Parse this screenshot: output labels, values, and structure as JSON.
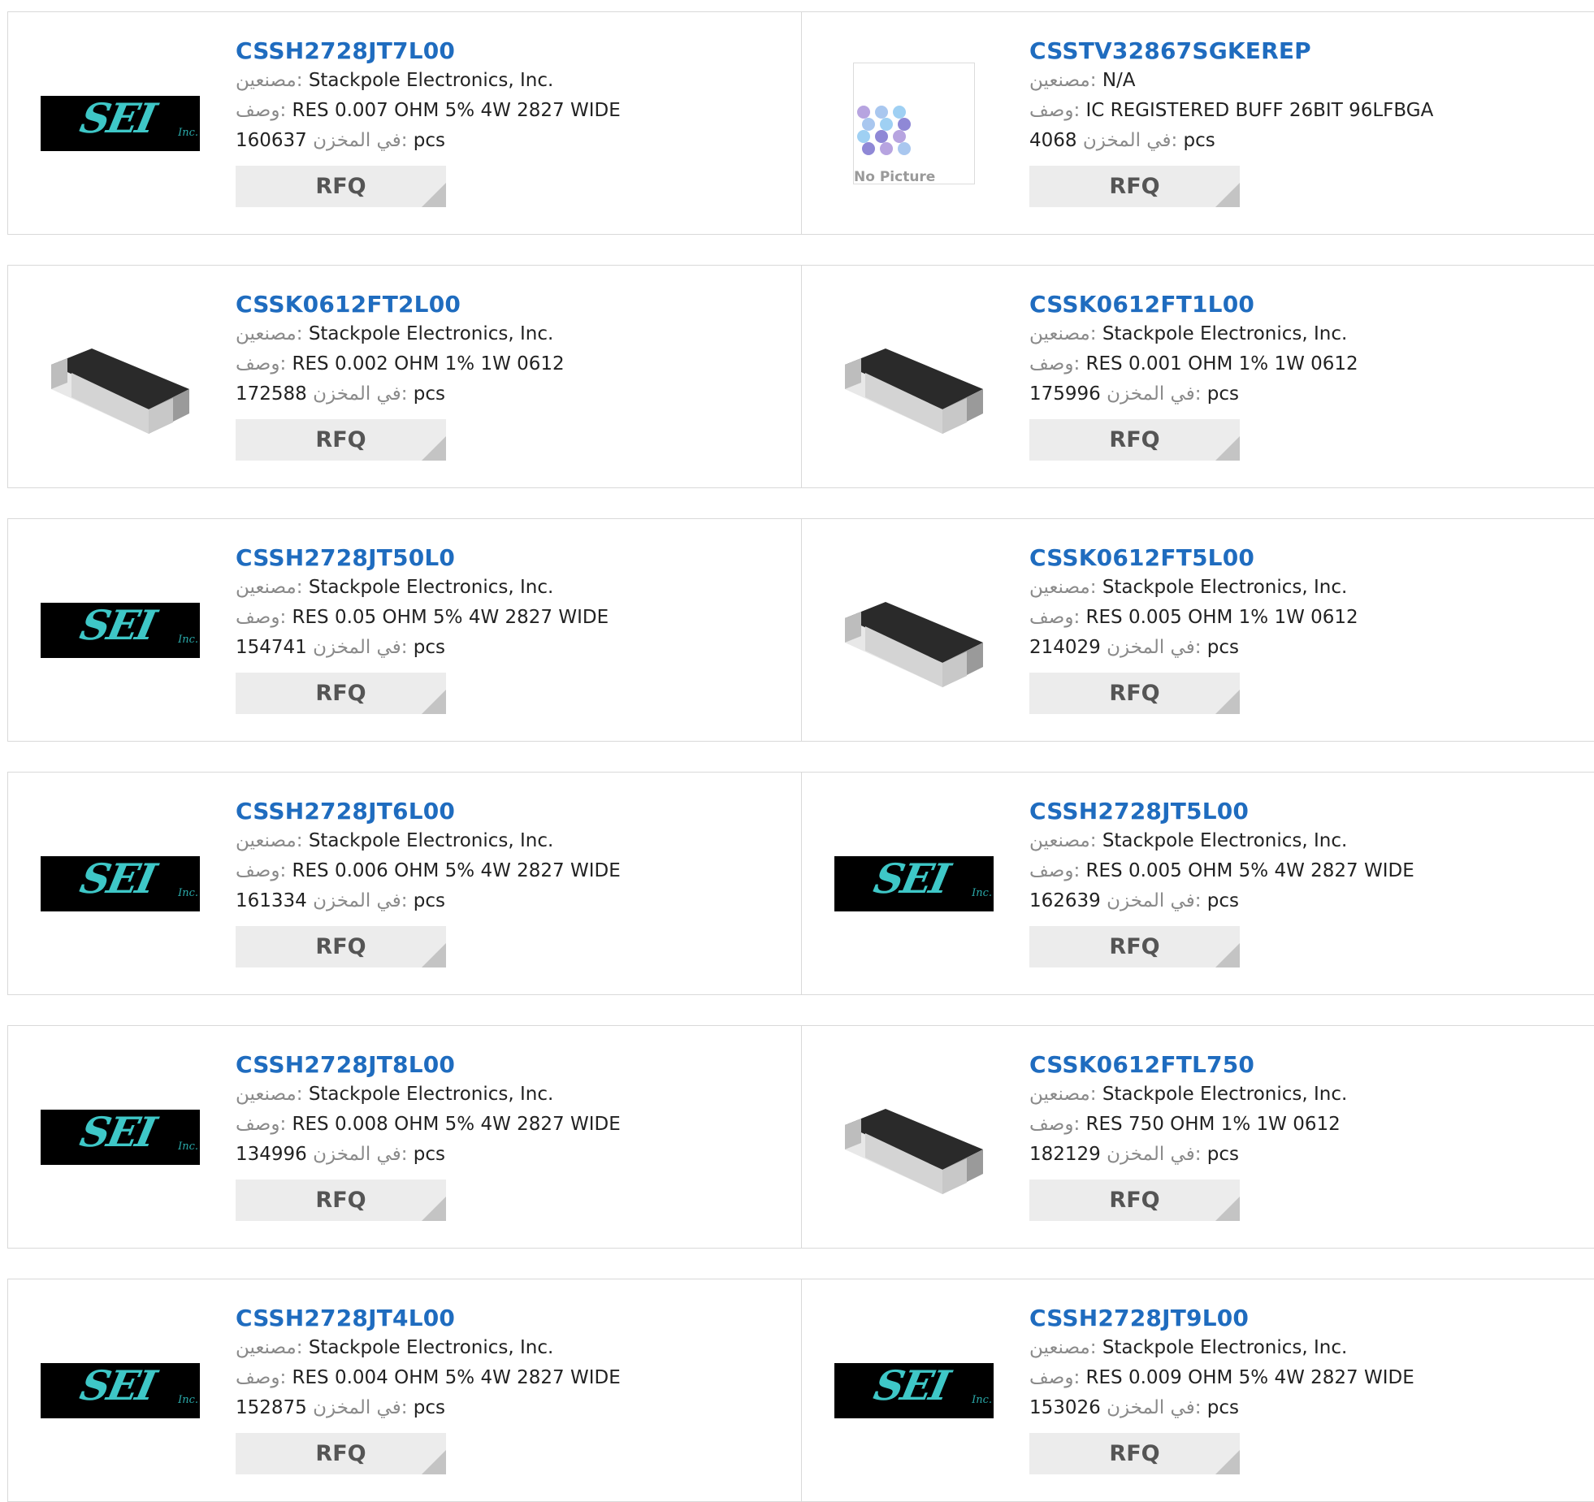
{
  "labels": {
    "manufacturer": "مصنعين:",
    "description": "وصف:",
    "stock": "في المخزن:",
    "unit": "pcs",
    "rfq": "RFQ",
    "no_picture": "No Picture",
    "logo_text": "SEI",
    "logo_inc": "Inc."
  },
  "colors": {
    "link": "#1f6cbf",
    "logo_teal": "#3ec7c7",
    "button_bg": "#ececec"
  },
  "products": [
    {
      "part": "CSSH2728JT7L00",
      "manufacturer": "Stackpole Electronics, Inc.",
      "description": "RES 0.007 OHM 5% 4W 2827 WIDE",
      "stock": "160637",
      "image": "sei-logo"
    },
    {
      "part": "CSSTV32867SGKEREP",
      "manufacturer": "N/A",
      "description": "IC REGISTERED BUFF 26BIT 96LFBGA",
      "stock": "4068",
      "image": "no-picture"
    },
    {
      "part": "CSSK0612FT2L00",
      "manufacturer": "Stackpole Electronics, Inc.",
      "description": "RES 0.002 OHM 1% 1W 0612",
      "stock": "172588",
      "image": "resistor-chip"
    },
    {
      "part": "CSSK0612FT1L00",
      "manufacturer": "Stackpole Electronics, Inc.",
      "description": "RES 0.001 OHM 1% 1W 0612",
      "stock": "175996",
      "image": "resistor-chip"
    },
    {
      "part": "CSSH2728JT50L0",
      "manufacturer": "Stackpole Electronics, Inc.",
      "description": "RES 0.05 OHM 5% 4W 2827 WIDE",
      "stock": "154741",
      "image": "sei-logo"
    },
    {
      "part": "CSSK0612FT5L00",
      "manufacturer": "Stackpole Electronics, Inc.",
      "description": "RES 0.005 OHM 1% 1W 0612",
      "stock": "214029",
      "image": "resistor-chip"
    },
    {
      "part": "CSSH2728JT6L00",
      "manufacturer": "Stackpole Electronics, Inc.",
      "description": "RES 0.006 OHM 5% 4W 2827 WIDE",
      "stock": "161334",
      "image": "sei-logo"
    },
    {
      "part": "CSSH2728JT5L00",
      "manufacturer": "Stackpole Electronics, Inc.",
      "description": "RES 0.005 OHM 5% 4W 2827 WIDE",
      "stock": "162639",
      "image": "sei-logo"
    },
    {
      "part": "CSSH2728JT8L00",
      "manufacturer": "Stackpole Electronics, Inc.",
      "description": "RES 0.008 OHM 5% 4W 2827 WIDE",
      "stock": "134996",
      "image": "sei-logo"
    },
    {
      "part": "CSSK0612FTL750",
      "manufacturer": "Stackpole Electronics, Inc.",
      "description": "RES 750 OHM 1% 1W 0612",
      "stock": "182129",
      "image": "resistor-chip"
    },
    {
      "part": "CSSH2728JT4L00",
      "manufacturer": "Stackpole Electronics, Inc.",
      "description": "RES 0.004 OHM 5% 4W 2827 WIDE",
      "stock": "152875",
      "image": "sei-logo"
    },
    {
      "part": "CSSH2728JT9L00",
      "manufacturer": "Stackpole Electronics, Inc.",
      "description": "RES 0.009 OHM 5% 4W 2827 WIDE",
      "stock": "153026",
      "image": "sei-logo"
    }
  ]
}
